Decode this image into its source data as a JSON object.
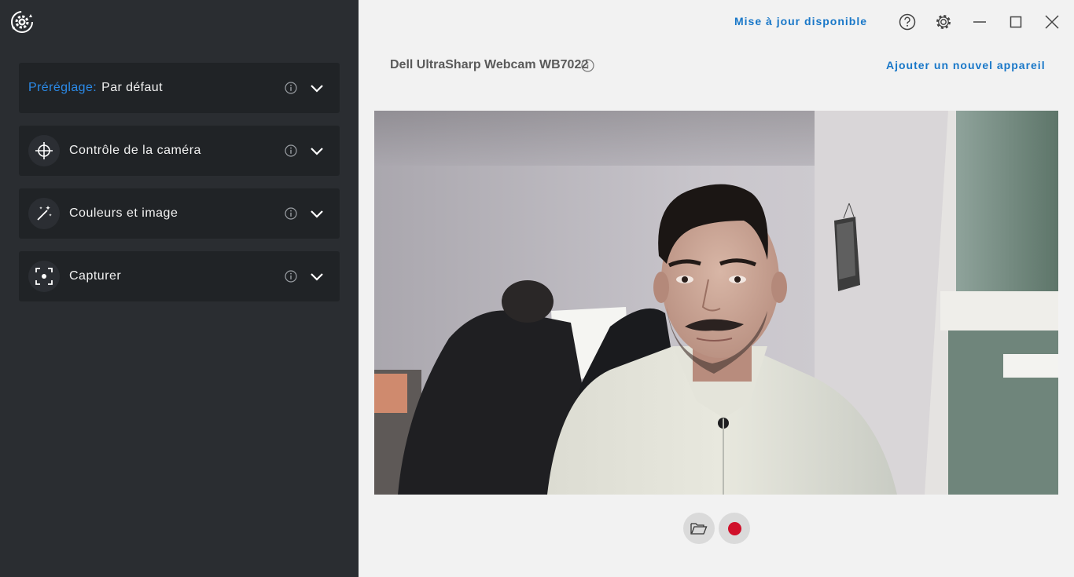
{
  "window": {
    "update_label": "Mise à jour disponible",
    "icons": [
      "app-logo-icon",
      "help-icon",
      "gear-icon",
      "minimize-icon",
      "maximize-icon",
      "close-icon"
    ]
  },
  "device": {
    "name": "Dell UltraSharp Webcam WB7022",
    "add_label": "Ajouter un nouvel appareil"
  },
  "sidebar": {
    "preset": {
      "key": "Préréglage:",
      "value": "Par défaut"
    },
    "items": [
      {
        "label": "Contrôle de la caméra",
        "icon": "crosshair-icon"
      },
      {
        "label": "Couleurs et image",
        "icon": "magic-wand-icon"
      },
      {
        "label": "Capturer",
        "icon": "capture-frame-icon"
      }
    ]
  },
  "colors": {
    "sidebar_bg": "#2a2d31",
    "panel_bg": "#202326",
    "accent_blue": "#1877c8",
    "record_red": "#d0102a"
  },
  "controls": {
    "icons": [
      "folder-icon",
      "record-icon"
    ]
  }
}
